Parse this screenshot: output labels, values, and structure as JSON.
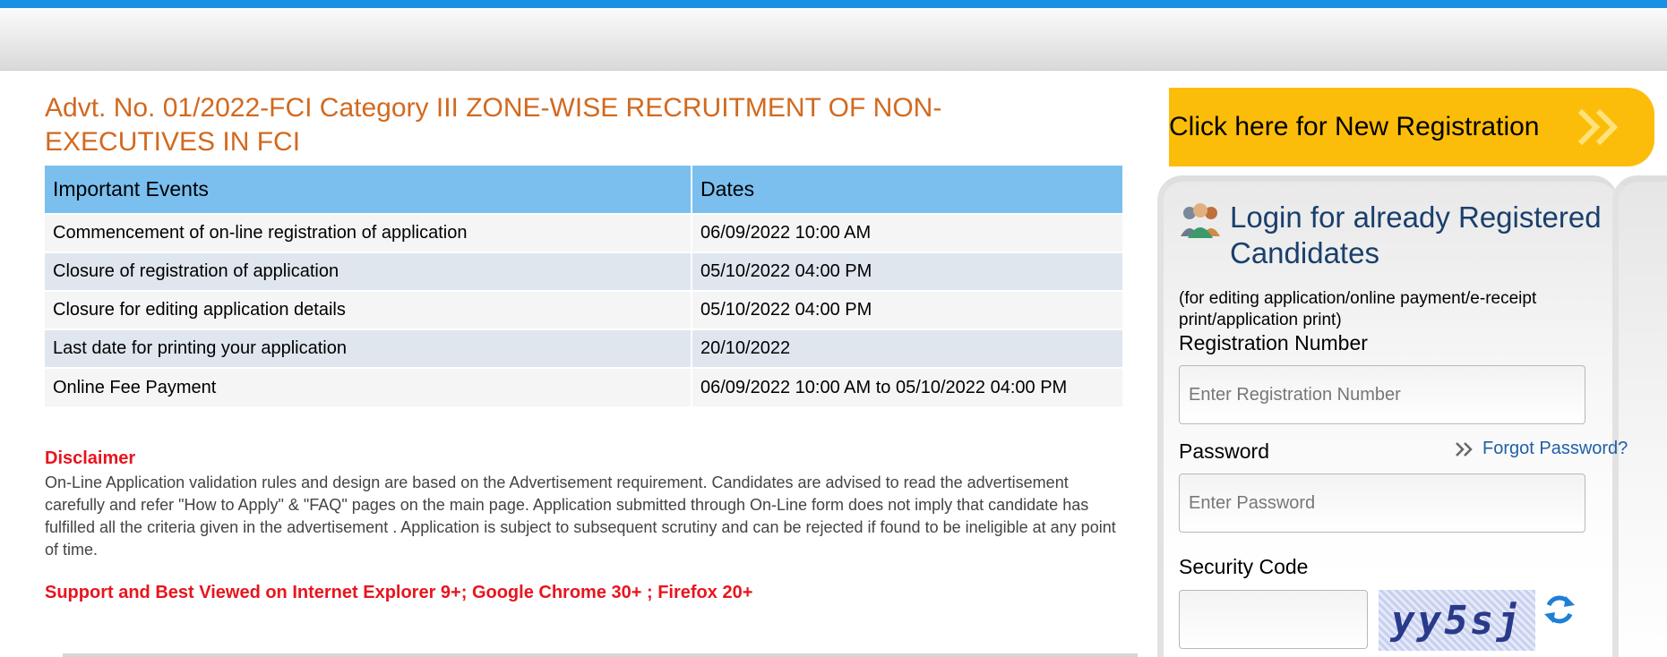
{
  "title": "Advt. No. 01/2022-FCI Category III ZONE-WISE RECRUITMENT OF NON-EXECUTIVES IN FCI",
  "events_table": {
    "headers": [
      "Important Events",
      "Dates"
    ],
    "rows": [
      [
        "Commencement of on-line registration of application",
        "06/09/2022 10:00 AM"
      ],
      [
        "Closure of registration of application",
        "05/10/2022 04:00 PM"
      ],
      [
        "Closure for editing application details",
        "05/10/2022 04:00 PM"
      ],
      [
        "Last date for printing your application",
        "20/10/2022"
      ],
      [
        "Online Fee Payment",
        "06/09/2022 10:00 AM to 05/10/2022 04:00 PM"
      ]
    ]
  },
  "disclaimer": {
    "title": "Disclaimer",
    "text": "On-Line Application validation rules and design are based on the Advertisement requirement. Candidates are advised to read the advertisement carefully and refer \"How to Apply\" & \"FAQ\" pages on the main page. Application submitted through On-Line form does not imply that candidate has fulfilled all the criteria given in the advertisement . Application is subject to subsequent scrutiny and can be rejected if found to be ineligible at any point of time."
  },
  "support_text": "Support and Best Viewed on Internet Explorer 9+; Google Chrome 30+ ; Firefox 20+",
  "registration_button": {
    "label": "Click here for New Registration",
    "icon": "double-chevron-right-icon"
  },
  "login": {
    "icon": "users-icon",
    "title": "Login for already Registered Candidates",
    "subtitle": "(for editing application/online payment/e-receipt print/application print)",
    "registration_label": "Registration Number",
    "registration_placeholder": "Enter Registration Number",
    "password_label": "Password",
    "password_placeholder": "Enter Password",
    "forgot_label": "Forgot Password?",
    "security_label": "Security Code",
    "captcha_text": "yy5sj",
    "refresh_icon": "refresh-icon"
  },
  "colors": {
    "top_bar": "#1a8fe6",
    "title": "#d2691e",
    "table_header": "#7bbfef",
    "registration_button": "#fcbd0a",
    "disclaimer": "#e8141e",
    "login_title": "#1a3f6c",
    "link": "#1f5fa8"
  }
}
